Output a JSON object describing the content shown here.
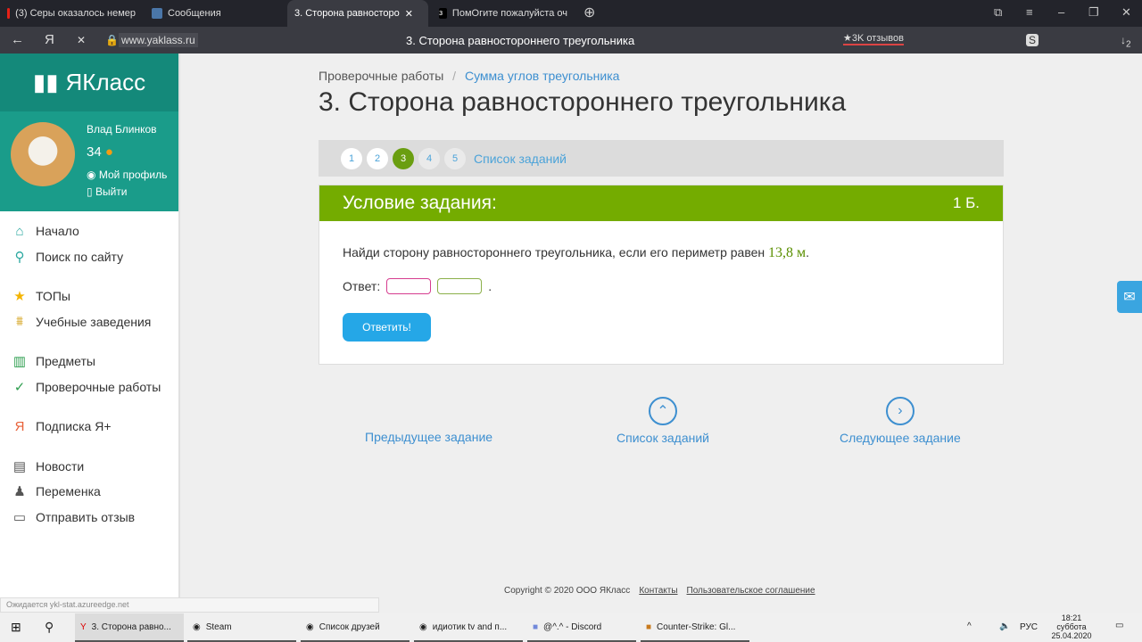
{
  "browser": {
    "tabs": [
      {
        "label": "(3) Серы оказалось немер",
        "color": "#e62117"
      },
      {
        "label": "Сообщения",
        "color": "#4a76a8"
      },
      {
        "label": "3. Сторона равносторо",
        "color": "#ffffff"
      },
      {
        "label": "ПомОгите пожалуйста оч",
        "color": "#000000"
      }
    ],
    "url": "www.yaklass.ru",
    "page_title": "3. Сторона равностороннего треугольника",
    "reviews": "★3K отзывов",
    "downloads_badge": "2"
  },
  "sidebar": {
    "logo": "ЯКласс",
    "user": "Влад Блинков",
    "points": "34",
    "profile": "Мой профиль",
    "logout": "Выйти",
    "items": [
      {
        "label": "Начало",
        "icon": "⌂",
        "color": "#2aa8a0"
      },
      {
        "label": "Поиск по сайту",
        "icon": "⌕",
        "color": "#2aa8a0"
      },
      {
        "label": "ТОПы",
        "icon": "★",
        "color": "#f4b400"
      },
      {
        "label": "Учебные заведения",
        "icon": "🏛",
        "color": "#d4a017"
      },
      {
        "label": "Предметы",
        "icon": "▥",
        "color": "#2e9e4f"
      },
      {
        "label": "Проверочные работы",
        "icon": "✓",
        "color": "#2e9e4f"
      },
      {
        "label": "Подписка Я+",
        "icon": "Я",
        "color": "#e8623a"
      },
      {
        "label": "Новости",
        "icon": "▤",
        "color": "#555"
      },
      {
        "label": "Переменка",
        "icon": "🔔",
        "color": "#555"
      },
      {
        "label": "Отправить отзыв",
        "icon": "▭",
        "color": "#555"
      }
    ]
  },
  "main": {
    "breadcrumb": [
      "Проверочные работы",
      "Сумма углов треугольника"
    ],
    "title": "3. Сторона равностороннего треугольника",
    "pages": [
      "1",
      "2",
      "3",
      "4",
      "5"
    ],
    "current_page": "3",
    "task_list": "Список заданий",
    "card_title": "Условие задания:",
    "score": "1 Б.",
    "question": "Найди сторону равностороннего треугольника, если его периметр равен ",
    "value": "13,8 м",
    "answer_label": "Ответ:",
    "submit": "Ответить!",
    "prev": "Предыдущее задание",
    "list": "Список заданий",
    "next": "Следующее задание"
  },
  "footer": {
    "copyright": "Copyright © 2020 ООО ЯКласс",
    "contacts": "Контакты",
    "agreement": "Пользовательское соглашение"
  },
  "status": "Ожидается ykl-stat.azureedge.net",
  "taskbar": {
    "items": [
      "3. Сторона равно...",
      "Steam",
      "Список друзей",
      "идиотик tv and п...",
      "@^.^ - Discord",
      "Counter-Strike: Gl..."
    ],
    "lang": "РУС",
    "time": "18:21",
    "day": "суббота",
    "date": "25.04.2020"
  }
}
